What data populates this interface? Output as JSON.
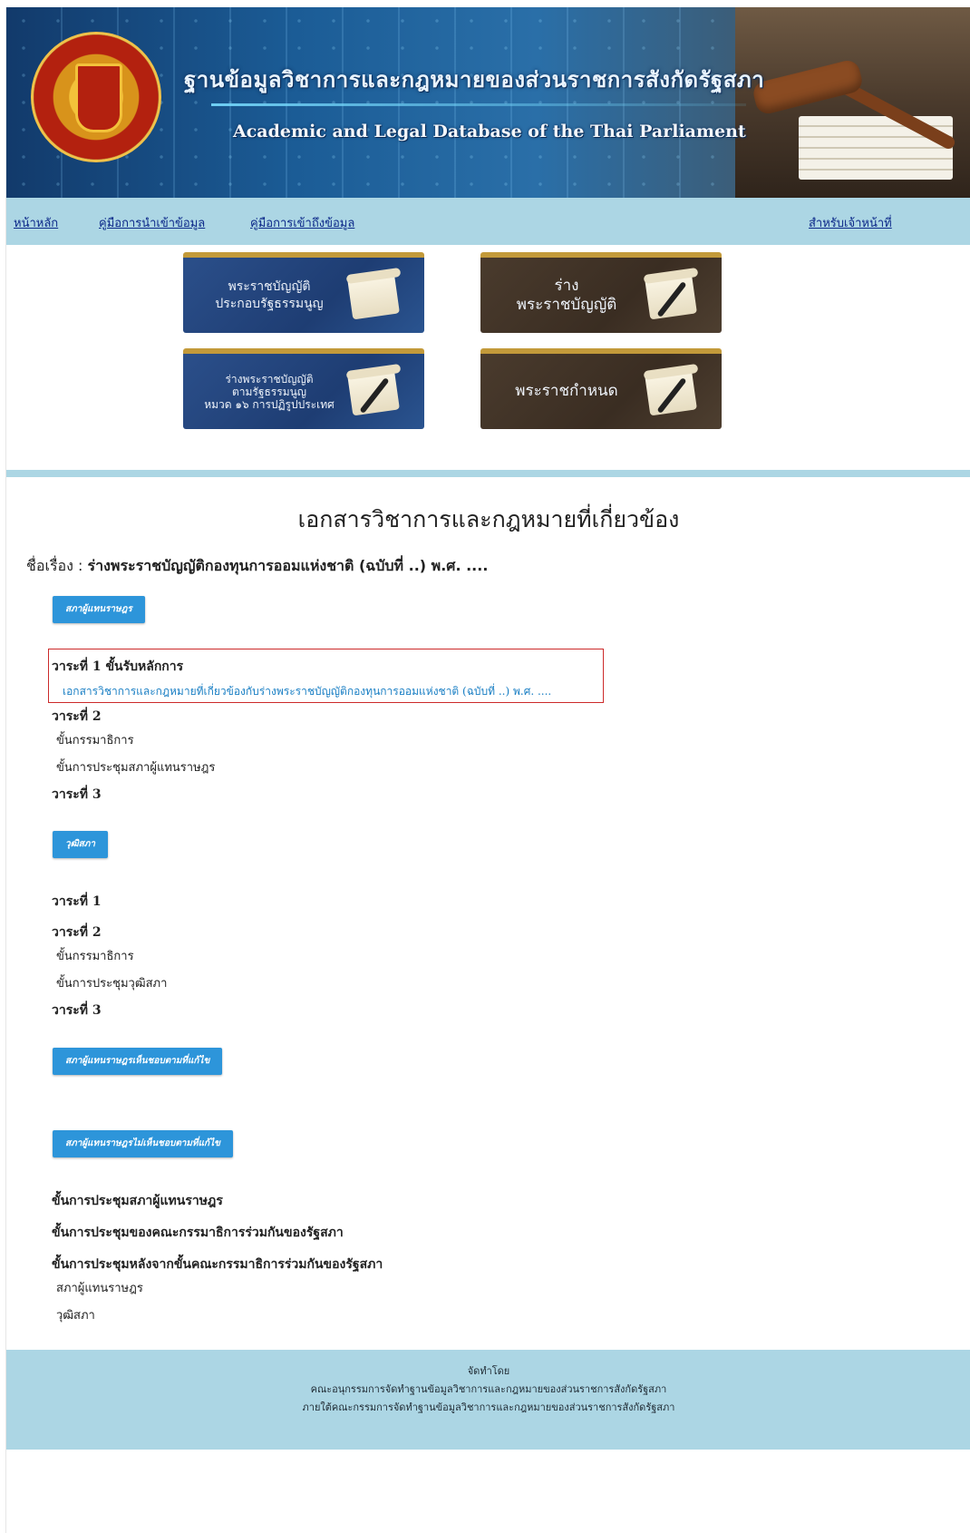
{
  "header": {
    "title_th": "ฐานข้อมูลวิชาการและกฎหมายของส่วนราชการสังกัดรัฐสภา",
    "title_en": "Academic and Legal Database of the Thai Parliament"
  },
  "nav": {
    "home": "หน้าหลัก",
    "input_guide": "คู่มือการนำเข้าข้อมูล",
    "access_guide": "คู่มือการเข้าถึงข้อมูล",
    "staff": "สำหรับเจ้าหน้าที่"
  },
  "tiles": [
    {
      "label": "พระราชบัญญัติ\nประกอบรัฐธรรมนูญ",
      "theme": "blue"
    },
    {
      "label": "ร่าง\nพระราชบัญญัติ",
      "theme": "brown"
    },
    {
      "label": "ร่างพระราชบัญญัติ\nตามรัฐธรรมนูญ\nหมวด ๑๖ การปฏิรูปประเทศ",
      "theme": "blue"
    },
    {
      "label": "พระราชกำหนด",
      "theme": "brown"
    }
  ],
  "main": {
    "page_title": "เอกสารวิชาการและกฎหมายที่เกี่ยวข้อง",
    "subject_label": "ชื่อเรื่อง : ",
    "subject_value": "ร่างพระราชบัญญัติกองทุนการออมแห่งชาติ (ฉบับที่ ..) พ.ศ. ....",
    "house": {
      "button": "สภาผู้แทนราษฎร",
      "reading1": "วาระที่ 1 ขั้นรับหลักการ",
      "reading1_doc": "เอกสารวิชาการและกฎหมายที่เกี่ยวข้องกับร่างพระราชบัญญัติกองทุนการออมแห่งชาติ (ฉบับที่ ..) พ.ศ. ....",
      "reading2": "วาระที่ 2",
      "committee": "ขั้นกรรมาธิการ",
      "house_meeting": "ขั้นการประชุมสภาผู้แทนราษฎร",
      "reading3": "วาระที่ 3"
    },
    "senate": {
      "button": "วุฒิสภา",
      "reading1": "วาระที่ 1",
      "reading2": "วาระที่ 2",
      "committee": "ขั้นกรรมาธิการ",
      "senate_meeting": "ขั้นการประชุมวุฒิสภา",
      "reading3": "วาระที่ 3"
    },
    "house_agree_button": "สภาผู้แทนราษฎรเห็นชอบตามที่แก้ไข",
    "house_disagree": {
      "button": "สภาผู้แทนราษฎรไม่เห็นชอบตามที่แก้ไข",
      "stage1": "ขั้นการประชุมสภาผู้แทนราษฎร",
      "stage2": "ขั้นการประชุมของคณะกรรมาธิการร่วมกันของรัฐสภา",
      "stage3": "ขั้นการประชุมหลังจากขั้นคณะกรรมาธิการร่วมกันของรัฐสภา",
      "sub1": "สภาผู้แทนราษฎร",
      "sub2": "วุฒิสภา"
    }
  },
  "footer": {
    "line1": "จัดทำโดย",
    "line2": "คณะอนุกรรมการจัดทำฐานข้อมูลวิชาการและกฎหมายของส่วนราชการสังกัดรัฐสภา",
    "line3": "ภายใต้คณะกรรมการจัดทำฐานข้อมูลวิชาการและกฎหมายของส่วนราชการสังกัดรัฐสภา"
  }
}
